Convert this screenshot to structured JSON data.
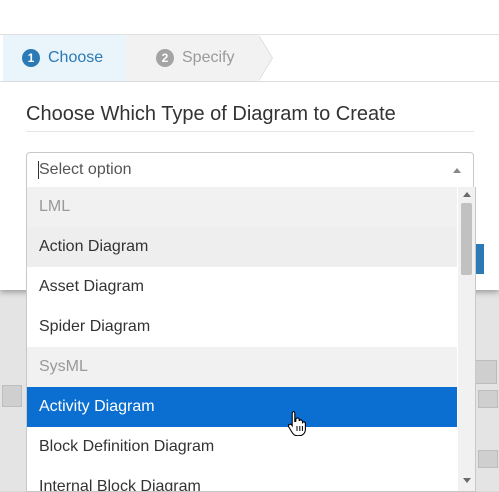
{
  "wizard": {
    "steps": [
      {
        "number": "1",
        "label": "Choose",
        "active": true
      },
      {
        "number": "2",
        "label": "Specify",
        "active": false
      }
    ]
  },
  "dialog": {
    "title": "Choose Which Type of Diagram to Create"
  },
  "select": {
    "value": "",
    "placeholder": "Select option"
  },
  "dropdown": {
    "options": [
      {
        "label": "LML",
        "kind": "group"
      },
      {
        "label": "Action Diagram",
        "kind": "option",
        "hover": true
      },
      {
        "label": "Asset Diagram",
        "kind": "option"
      },
      {
        "label": "Spider Diagram",
        "kind": "option"
      },
      {
        "label": "SysML",
        "kind": "group"
      },
      {
        "label": "Activity Diagram",
        "kind": "option",
        "selected": true
      },
      {
        "label": "Block Definition Diagram",
        "kind": "option"
      },
      {
        "label": "Internal Block Diagram",
        "kind": "option"
      }
    ]
  },
  "colors": {
    "accent": "#2b7ab6",
    "selected_bg": "#0a6fd1",
    "group_text": "#999999"
  },
  "icons": {
    "select_arrow": "caret-up-icon",
    "scroll_up": "scroll-up-icon",
    "scroll_down": "scroll-down-icon",
    "cursor": "hand-pointer-icon"
  }
}
